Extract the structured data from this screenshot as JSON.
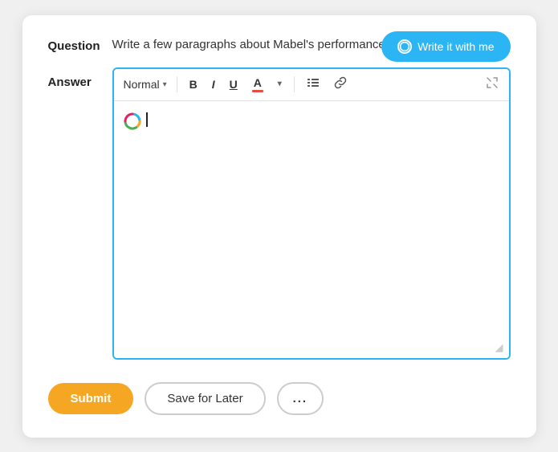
{
  "question": {
    "label": "Question",
    "text": "Write a few paragraphs about Mabel's performance."
  },
  "write_with_me_btn": {
    "label": "Write it with me",
    "icon": "circle-icon"
  },
  "answer": {
    "label": "Answer"
  },
  "toolbar": {
    "format_label": "Normal",
    "bold_label": "B",
    "italic_label": "I",
    "underline_label": "U",
    "color_label": "A",
    "list_label": "≡",
    "link_label": "🔗"
  },
  "bottom_bar": {
    "submit_label": "Submit",
    "save_later_label": "Save for Later",
    "more_label": "..."
  }
}
